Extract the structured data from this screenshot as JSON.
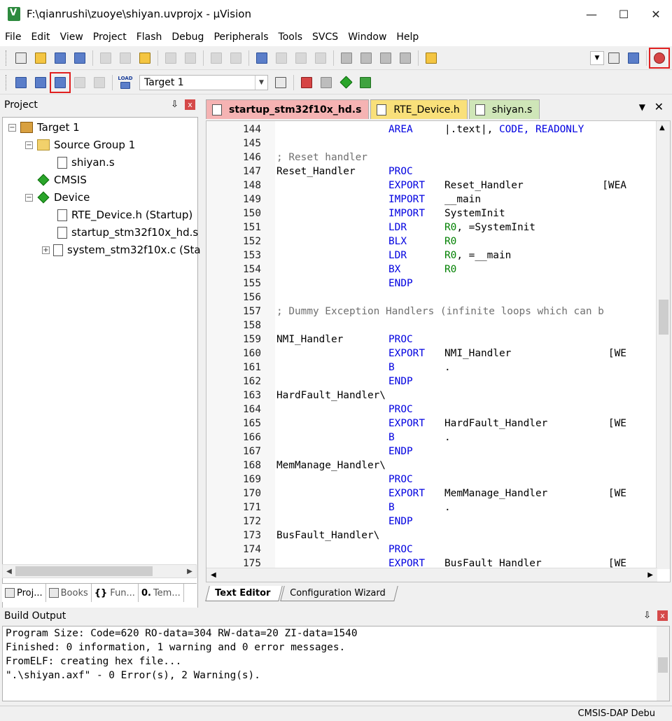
{
  "window": {
    "title": "F:\\qianrushi\\zuoye\\shiyan.uvprojx - µVision",
    "minimize": "—",
    "maximize": "☐",
    "close": "✕"
  },
  "menu": [
    "File",
    "Edit",
    "View",
    "Project",
    "Flash",
    "Debug",
    "Peripherals",
    "Tools",
    "SVCS",
    "Window",
    "Help"
  ],
  "toolbar2": {
    "target_value": "Target 1",
    "load_label": "LOAD"
  },
  "project_panel": {
    "title": "Project",
    "pin": "⇩",
    "close": "x",
    "tree": [
      {
        "label": "Target 1",
        "expander": "−"
      },
      {
        "label": "Source Group 1",
        "expander": "−"
      },
      {
        "label": "shiyan.s"
      },
      {
        "label": "CMSIS"
      },
      {
        "label": "Device",
        "expander": "−"
      },
      {
        "label": "RTE_Device.h (Startup)"
      },
      {
        "label": "startup_stm32f10x_hd.s"
      },
      {
        "label": "system_stm32f10x.c (Sta",
        "expander": "+"
      }
    ],
    "tabs": [
      "Proj...",
      "Books",
      "Fun...",
      "Tem..."
    ],
    "tab_glyphs": [
      "",
      "",
      "{}",
      "0."
    ]
  },
  "editor": {
    "tabs": [
      "startup_stm32f10x_hd.s",
      "RTE_Device.h",
      "shiyan.s"
    ],
    "tab_menu": "▼",
    "tab_close": "✕",
    "lines": [
      {
        "n": "144",
        "label": "",
        "op": "AREA",
        "arg": "|.text|, ",
        "kw2": "CODE, READONLY"
      },
      {
        "n": "145"
      },
      {
        "n": "146",
        "comment": "; Reset handler"
      },
      {
        "n": "147",
        "label": "Reset_Handler",
        "op": "PROC"
      },
      {
        "n": "148",
        "op": "EXPORT",
        "arg": "Reset_Handler             [WEA"
      },
      {
        "n": "149",
        "op": "IMPORT",
        "arg": "__main"
      },
      {
        "n": "150",
        "op": "IMPORT",
        "arg": "SystemInit"
      },
      {
        "n": "151",
        "op": "LDR",
        "reg": "R0",
        "arg": ", =SystemInit"
      },
      {
        "n": "152",
        "op": "BLX",
        "reg": "R0"
      },
      {
        "n": "153",
        "op": "LDR",
        "reg": "R0",
        "arg": ", =__main"
      },
      {
        "n": "154",
        "op": "BX",
        "reg": "R0"
      },
      {
        "n": "155",
        "op": "ENDP"
      },
      {
        "n": "156"
      },
      {
        "n": "157",
        "comment": "; Dummy Exception Handlers (infinite loops which can b"
      },
      {
        "n": "158"
      },
      {
        "n": "159",
        "label": "NMI_Handler",
        "op": "PROC"
      },
      {
        "n": "160",
        "op": "EXPORT",
        "arg": "NMI_Handler                [WE"
      },
      {
        "n": "161",
        "op": "B",
        "arg": "."
      },
      {
        "n": "162",
        "op": "ENDP"
      },
      {
        "n": "163",
        "label": "HardFault_Handler\\"
      },
      {
        "n": "164",
        "op": "PROC"
      },
      {
        "n": "165",
        "op": "EXPORT",
        "arg": "HardFault_Handler          [WE"
      },
      {
        "n": "166",
        "op": "B",
        "arg": "."
      },
      {
        "n": "167",
        "op": "ENDP"
      },
      {
        "n": "168",
        "label": "MemManage_Handler\\"
      },
      {
        "n": "169",
        "op": "PROC"
      },
      {
        "n": "170",
        "op": "EXPORT",
        "arg": "MemManage_Handler          [WE"
      },
      {
        "n": "171",
        "op": "B",
        "arg": "."
      },
      {
        "n": "172",
        "op": "ENDP"
      },
      {
        "n": "173",
        "label": "BusFault_Handler\\"
      },
      {
        "n": "174",
        "op": "PROC"
      },
      {
        "n": "175",
        "op": "EXPORT",
        "arg": "BusFault_Handler           [WE"
      }
    ],
    "bottom_tabs": [
      "Text Editor",
      "Configuration Wizard"
    ]
  },
  "build_output": {
    "title": "Build Output",
    "pin": "⇩",
    "close": "x",
    "lines": [
      "Program Size: Code=620 RO-data=304 RW-data=20 ZI-data=1540",
      "Finished: 0 information, 1 warning and 0 error messages.",
      "FromELF: creating hex file...",
      "\".\\shiyan.axf\" - 0 Error(s), 2 Warning(s)."
    ]
  },
  "status": {
    "debugger": "CMSIS-DAP Debu"
  }
}
